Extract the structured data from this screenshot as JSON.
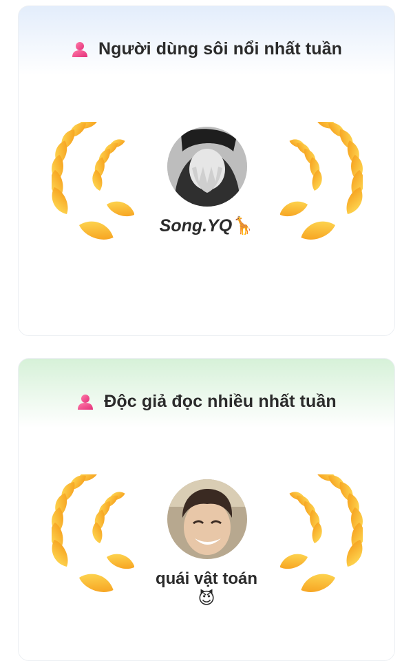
{
  "cards": [
    {
      "title": "Người dùng sôi nổi nhất tuần",
      "header_icon": "user-icon",
      "accent": "#e3edfb",
      "user": {
        "name": "Song.YQ",
        "emoji": "🦒"
      }
    },
    {
      "title": "Độc giả đọc nhiều nhất tuần",
      "header_icon": "user-icon",
      "accent": "#d6f1d8",
      "user": {
        "name": "quái vật toán",
        "emoji": "😈"
      }
    }
  ],
  "colors": {
    "laurel_light": "#ffd23c",
    "laurel_dark": "#f7a21a",
    "icon_pink": "#f0428a"
  }
}
